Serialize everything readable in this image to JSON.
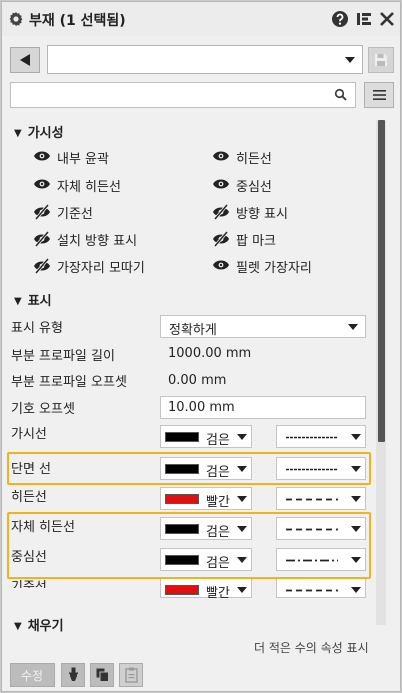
{
  "title": "부재 (1 선택됨)",
  "visibility": {
    "header": "가시성",
    "items": [
      {
        "label": "내부 윤곽",
        "icon": "eye-icon"
      },
      {
        "label": "히든선",
        "icon": "eye-icon"
      },
      {
        "label": "자체 히든선",
        "icon": "eye-icon"
      },
      {
        "label": "중심선",
        "icon": "eye-icon"
      },
      {
        "label": "기준선",
        "icon": "eye-slash-icon"
      },
      {
        "label": "방향 표시",
        "icon": "eye-slash-icon"
      },
      {
        "label": "설치 방향 표시",
        "icon": "eye-slash-icon"
      },
      {
        "label": "팝 마크",
        "icon": "eye-slash-icon"
      },
      {
        "label": "가장자리 모따기",
        "icon": "eye-slash-icon"
      },
      {
        "label": "필렛 가장자리",
        "icon": "eye-icon"
      }
    ]
  },
  "display": {
    "header": "표시",
    "display_type_label": "표시 유형",
    "display_type_value": "정확하게",
    "profile_length_label": "부분 프로파일 길이",
    "profile_length_value": "1000.00 mm",
    "profile_offset_label": "부분 프로파일 오프셋",
    "profile_offset_value": "0.00 mm",
    "symbol_offset_label": "기호 오프셋",
    "symbol_offset_value": "10.00 mm",
    "lines": [
      {
        "label": "가시선",
        "color_name": "검은",
        "color": "#000000",
        "pattern": "dashed-fine"
      },
      {
        "label": "단면 선",
        "color_name": "검은",
        "color": "#000000",
        "pattern": "dashed-fine"
      },
      {
        "label": "히든선",
        "color_name": "빨간",
        "color": "#e01010",
        "pattern": "dashed"
      },
      {
        "label": "자체 히든선",
        "color_name": "검은",
        "color": "#000000",
        "pattern": "dashed"
      },
      {
        "label": "중심선",
        "color_name": "검은",
        "color": "#000000",
        "pattern": "dash-dot"
      },
      {
        "label": "기준선",
        "color_name": "빨간",
        "color": "#e01010",
        "pattern": "dashed"
      }
    ]
  },
  "fill": {
    "header": "채우기"
  },
  "more_link": "더 적은 수의 속성 표시",
  "bottom": {
    "edit_label": "수정"
  },
  "colors": {
    "highlight": "#f2b21c"
  }
}
